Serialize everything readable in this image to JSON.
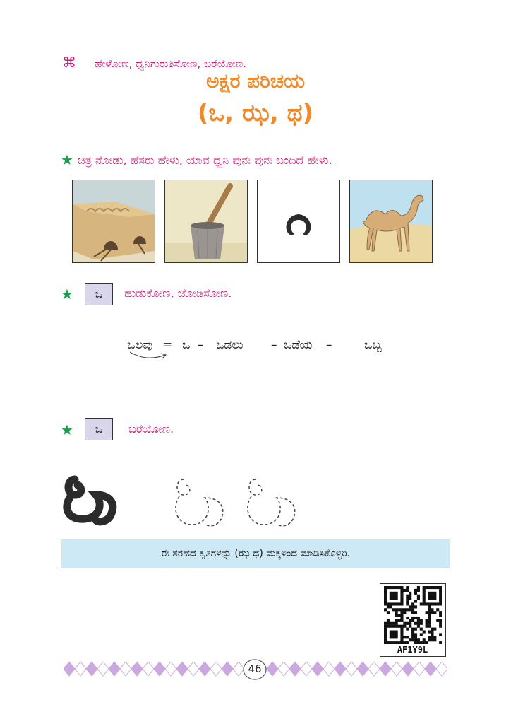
{
  "header": {
    "symbol": "⌘",
    "instruction": "ಹೇಳೋಣ, ಧ್ವನಿಗುರುತಿಸೋಣ, ಬರೆಯೋಣ.",
    "title": "ಅಕ್ಷರ ಪರಿಚಯ",
    "subtitle": "(ಒ, ಝ, ಥ)"
  },
  "section1": {
    "instruction": "ಚಿತ್ರ ನೋಡು, ಹೆಸರು ಹೇಳು, ಯಾವ ಧ್ವನಿ ಪುನಃ ಪುನಃ ಬಂದಿದೆ ಹೇಳು.",
    "pictures": [
      "clay-oven-icon",
      "mortar-pestle-icon",
      "horseshoe-icon",
      "camel-icon"
    ]
  },
  "section2": {
    "letter": "ಒ",
    "instruction": "ಹುಡುಕೋಣ, ಜೋಡಿಸೋಣ.",
    "words": {
      "w1": "ಒಲವು",
      "eq": "=",
      "letter": "ಒ",
      "dash1": "–",
      "w2": "ಒಡಲು",
      "dash2": "–",
      "w3": "ಒಡೆಯ",
      "dash3": "–",
      "w4": "ಒಬ್ಬ"
    }
  },
  "section3": {
    "letter": "ಒ",
    "instruction": "ಬರೆಯೋಣ.",
    "big_letter": "ಒ"
  },
  "note": "ಈ ತರಹದ ಕೃತಿಗಳನ್ನು (ಝ ಥ) ಮಕ್ಕಳಿಂದ ಮಾಡಿಸಿಕೊಳ್ಳಿರಿ.",
  "qr": {
    "code": "AF1Y9L"
  },
  "footer": {
    "page_number": "46"
  },
  "colors": {
    "pink": "#d6187a",
    "orange": "#ef8a2a",
    "green": "#1b9e4b",
    "box": "#d9d6ec",
    "note_bg": "#cde9f6",
    "border": "#c9a9e0"
  }
}
